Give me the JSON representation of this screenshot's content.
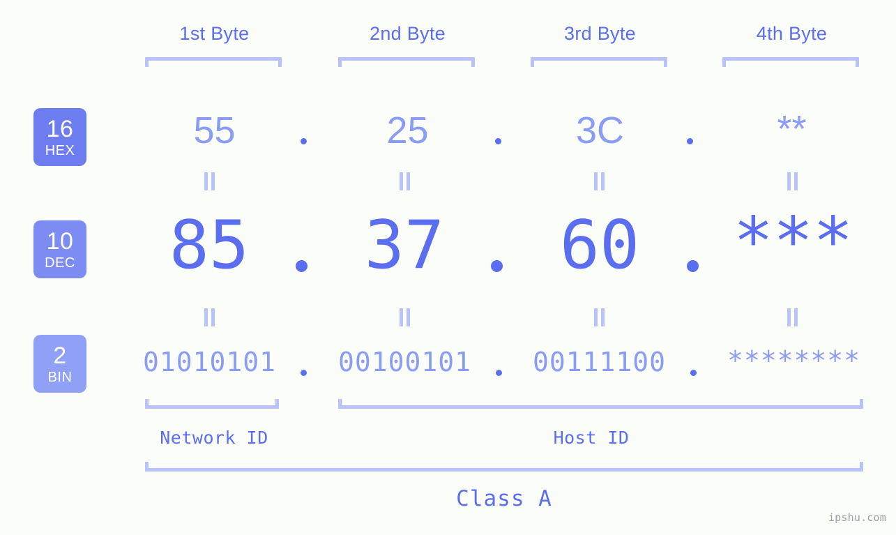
{
  "page": {
    "background_color": "#fbfdf8",
    "accent_color": "#5b6ef0",
    "accent_light_color": "#8b9cf5",
    "bracket_color": "#b9c2fb",
    "badge_color": "#6d7df0",
    "badge_color_light": "#8b9cf5",
    "watermark": "ipshu.com"
  },
  "headers": [
    {
      "label": "1st Byte"
    },
    {
      "label": "2nd Byte"
    },
    {
      "label": "3rd Byte"
    },
    {
      "label": "4th Byte"
    }
  ],
  "bases": [
    {
      "num": "16",
      "name": "HEX"
    },
    {
      "num": "10",
      "name": "DEC"
    },
    {
      "num": "2",
      "name": "BIN"
    }
  ],
  "rows": {
    "hex": {
      "base_num": "16",
      "base_name": "HEX",
      "values": [
        "55",
        "25",
        "3C",
        "**"
      ],
      "separator": "."
    },
    "dec": {
      "base_num": "10",
      "base_name": "DEC",
      "values": [
        "85",
        "37",
        "60",
        "***"
      ],
      "separator": "."
    },
    "bin": {
      "base_num": "2",
      "base_name": "BIN",
      "values": [
        "01010101",
        "00100101",
        "00111100",
        "********"
      ],
      "separator": "."
    }
  },
  "equals_glyph": "=",
  "sections": [
    {
      "label": "Network ID"
    },
    {
      "label": "Host ID"
    }
  ],
  "class": {
    "label": "Class A"
  }
}
